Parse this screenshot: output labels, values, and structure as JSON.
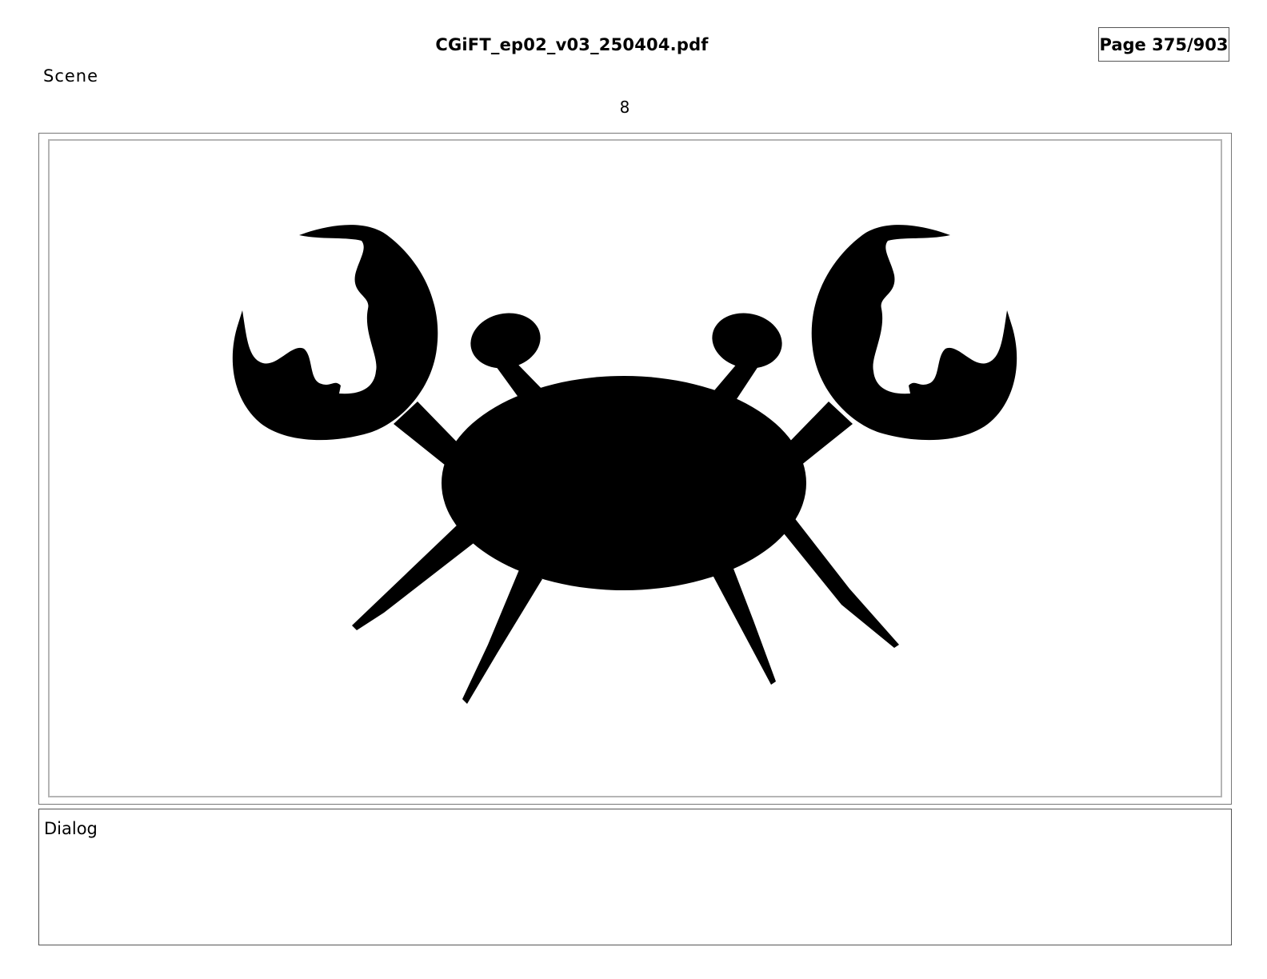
{
  "document": {
    "filename": "CGiFT_ep02_v03_250404.pdf",
    "page_indicator": "Page 375/903"
  },
  "scene": {
    "label": "Scene",
    "number": "8"
  },
  "panel": {
    "image_subject": "crab-silhouette",
    "fill_color": "#000000"
  },
  "dialog": {
    "label": "Dialog",
    "text": ""
  }
}
